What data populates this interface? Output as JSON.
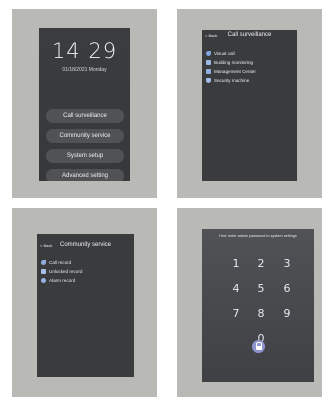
{
  "screen1": {
    "time": "14 29",
    "date": "01/18/2021 Monday",
    "buttons": [
      "Call surveillance",
      "Community service",
      "System setup",
      "Advanced setting"
    ]
  },
  "screen2": {
    "back": "< Back",
    "title": "Call surveillance",
    "items": [
      {
        "label": "Visual call",
        "icon": "phone-icon"
      },
      {
        "label": "Building monitoring",
        "icon": "camera-icon"
      },
      {
        "label": "Management Center",
        "icon": "building-icon"
      },
      {
        "label": "Security machine",
        "icon": "shield-icon"
      }
    ]
  },
  "screen3": {
    "back": "< Back",
    "title": "Community service",
    "items": [
      {
        "label": "Call record",
        "icon": "call-record-icon"
      },
      {
        "label": "Unlocked record",
        "icon": "unlock-icon"
      },
      {
        "label": "Alarm record",
        "icon": "alarm-icon"
      }
    ]
  },
  "screen4": {
    "hint": "Hint: enter admin password to system settings",
    "keys": [
      "1",
      "2",
      "3",
      "4",
      "5",
      "6",
      "7",
      "8",
      "9",
      "0"
    ]
  },
  "colors": {
    "panel": "#b9b9b6",
    "screen": "#3a3b3d",
    "pill": "#505256",
    "lock_button": "#8d95cf",
    "icon_accent": "#8fb0e0"
  }
}
